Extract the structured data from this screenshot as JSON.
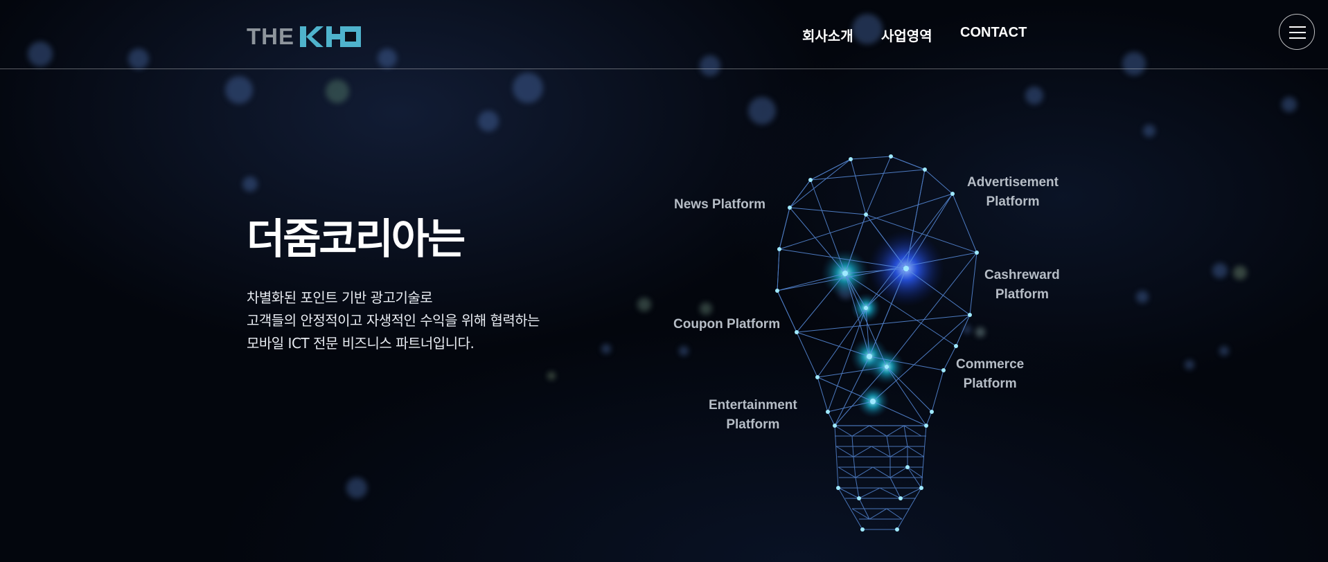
{
  "header": {
    "logo_prefix": "THE",
    "logo_mark_colors": {
      "mark": "#4fb3cc"
    },
    "nav": [
      "회사소개",
      "사업영역",
      "CONTACT"
    ],
    "menu_icon": "hamburger-icon"
  },
  "hero": {
    "title": "더줌코리아는",
    "desc_lines": [
      "차별화된 포인트 기반 광고기술로",
      "고객들의 안정적이고 자생적인 수익을 위해 협력하는",
      "모바일 ICT 전문 비즈니스 파트너입니다."
    ]
  },
  "platforms": {
    "news": [
      "News Platform"
    ],
    "advertisement": [
      "Advertisement",
      "Platform"
    ],
    "cashreward": [
      "Cashreward",
      "Platform"
    ],
    "coupon": [
      "Coupon Platform"
    ],
    "commerce": [
      "Commerce",
      "Platform"
    ],
    "entertainment": [
      "Entertainment",
      "Platform"
    ]
  },
  "colors": {
    "background": "#03060d",
    "accent": "#4fb3cc",
    "label": "#b6bdc6",
    "bulb_line": "#5a8fe0"
  }
}
